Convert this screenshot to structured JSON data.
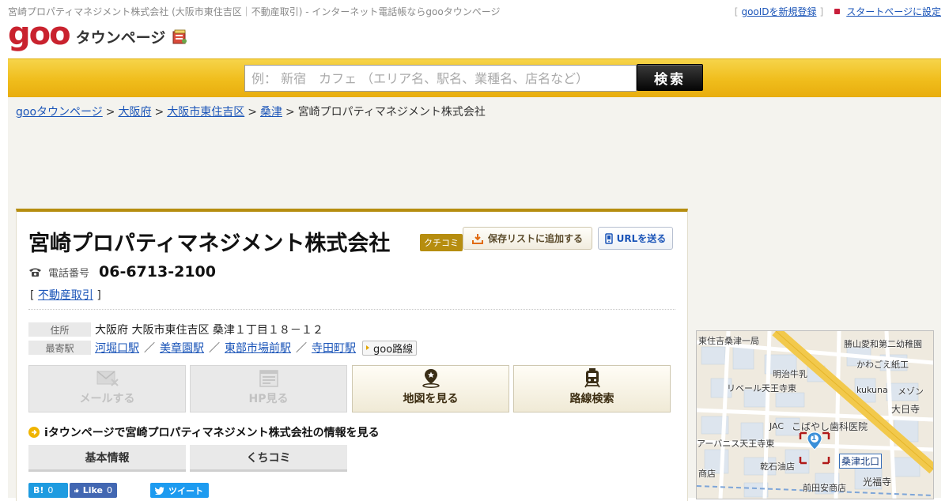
{
  "header": {
    "page_title": "宮崎プロパティマネジメント株式会社 (大阪市東住吉区｜不動産取引) - インターネット電話帳ならgooタウンページ",
    "logo_goo": "goo",
    "logo_text": "タウンページ",
    "links": [
      {
        "label": "gooIDを新規登録"
      },
      {
        "label": "スタートページに設定"
      }
    ]
  },
  "search": {
    "placeholder": "例： 新宿　カフェ （エリア名、駅名、業種名、店名など）",
    "button_label": "検索"
  },
  "breadcrumb": {
    "items": [
      "gooタウンページ",
      "大阪府",
      "大阪市東住吉区",
      "桑津"
    ],
    "separator": ">",
    "current": "宮崎プロパティマネジメント株式会社"
  },
  "business": {
    "name": "宮崎プロパティマネジメント株式会社",
    "badge": "クチコミ",
    "save_button": "保存リストに追加する",
    "send_url_button": "URLを送る",
    "phone_label": "電話番号",
    "phone": "06-6713-2100",
    "category": "不動産取引",
    "address_label": "住所",
    "address": "大阪府 大阪市東住吉区 桑津１丁目１８－１２",
    "station_label": "最寄駅",
    "stations": [
      "河堀口駅",
      "美章園駅",
      "東部市場前駅",
      "寺田町駅"
    ],
    "goo_route": "goo路線"
  },
  "actions": {
    "mail": "メールする",
    "hp": "HP見る",
    "map": "地図を見る",
    "route": "路線検索"
  },
  "itown": {
    "text": "iタウンページで宮崎プロパティマネジメント株式会社の情報を見る",
    "tabs": [
      "基本情報",
      "くちコミ"
    ]
  },
  "social": {
    "hatena_label": "B!",
    "hatena_count": "0",
    "fb_label": "Like",
    "fb_count": "0",
    "tweet_label": "ツイート"
  },
  "map": {
    "labels": [
      "東住吉桑津一局",
      "勝山愛和第二幼稚園",
      "明治牛乳",
      "かわごえ紙工",
      "リベール天王寺東",
      "kukuna",
      "メゾン",
      "大日寺",
      "JAC",
      "こばやし歯科医院",
      "アーバニス天王寺東",
      "乾石油店",
      "桑津北口",
      "光福寺",
      "前田安商店",
      "商店"
    ],
    "marker_number": "1"
  },
  "colors": {
    "brand_red": "#c9222e",
    "accent_gold": "#b68d0f",
    "search_band": "#f0bd1c",
    "link_blue": "#1a54b8"
  }
}
